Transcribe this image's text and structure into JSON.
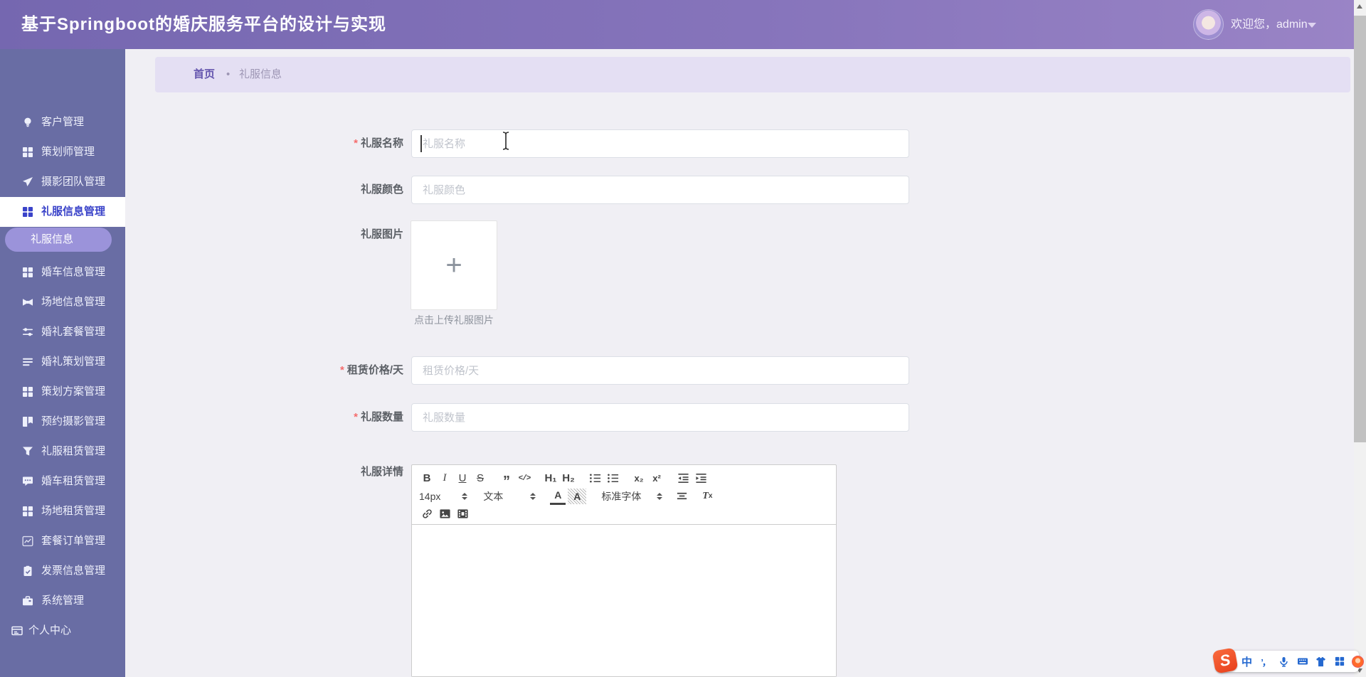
{
  "header": {
    "title": "基于Springboot的婚庆服务平台的设计与实现",
    "welcome": "欢迎您，",
    "username": "admin"
  },
  "sidebar": {
    "items": [
      {
        "label": "客户管理"
      },
      {
        "label": "策划师管理"
      },
      {
        "label": "摄影团队管理"
      },
      {
        "label": "礼服信息管理"
      },
      {
        "label": "婚车信息管理"
      },
      {
        "label": "场地信息管理"
      },
      {
        "label": "婚礼套餐管理"
      },
      {
        "label": "婚礼策划管理"
      },
      {
        "label": "策划方案管理"
      },
      {
        "label": "预约摄影管理"
      },
      {
        "label": "礼服租赁管理"
      },
      {
        "label": "婚车租赁管理"
      },
      {
        "label": "场地租赁管理"
      },
      {
        "label": "套餐订单管理"
      },
      {
        "label": "发票信息管理"
      },
      {
        "label": "系统管理"
      }
    ],
    "active_item": "礼服信息管理",
    "submenu_label": "礼服信息",
    "personal_center_label": "个人中心"
  },
  "breadcrumb": {
    "home": "首页",
    "separator": "•",
    "current": "礼服信息"
  },
  "form": {
    "required_mark": "*",
    "fields": [
      {
        "label": "礼服名称",
        "placeholder": "礼服名称",
        "required": true
      },
      {
        "label": "礼服颜色",
        "placeholder": "礼服颜色",
        "required": false
      },
      {
        "label": "礼服图片",
        "required": false
      },
      {
        "label": "租赁价格/天",
        "placeholder": "租赁价格/天",
        "required": true
      },
      {
        "label": "礼服数量",
        "placeholder": "礼服数量",
        "required": true
      },
      {
        "label": "礼服详情",
        "required": false
      }
    ],
    "upload": {
      "plus_sign": "+",
      "hint": "点击上传礼服图片"
    },
    "editor": {
      "size_value": "14px",
      "style_value": "文本",
      "font_value": "标准字体",
      "glyphs": {
        "bold": "B",
        "italic": "I",
        "underline": "U",
        "strike": "S",
        "quote": "”",
        "code": "</>",
        "h1": "H₁",
        "h2": "H₂",
        "sub": "x₂",
        "sup": "x²",
        "color": "A",
        "background": "A",
        "clean_t": "T",
        "clean_x": "x"
      }
    }
  },
  "ime": {
    "sogou_letter": "S",
    "chinese_mode": "中",
    "punctuation": "’，"
  },
  "colors": {
    "header_gradient_start": "#7567b0",
    "header_gradient_end": "#9a84c6",
    "sidebar_bg": "#696da4",
    "active_text": "#3a43c9",
    "submenu_pill": "#9b93da",
    "breadcrumb_bg": "#e4dff3",
    "content_bg": "#f0eff4",
    "required_red": "#f56c6c"
  }
}
